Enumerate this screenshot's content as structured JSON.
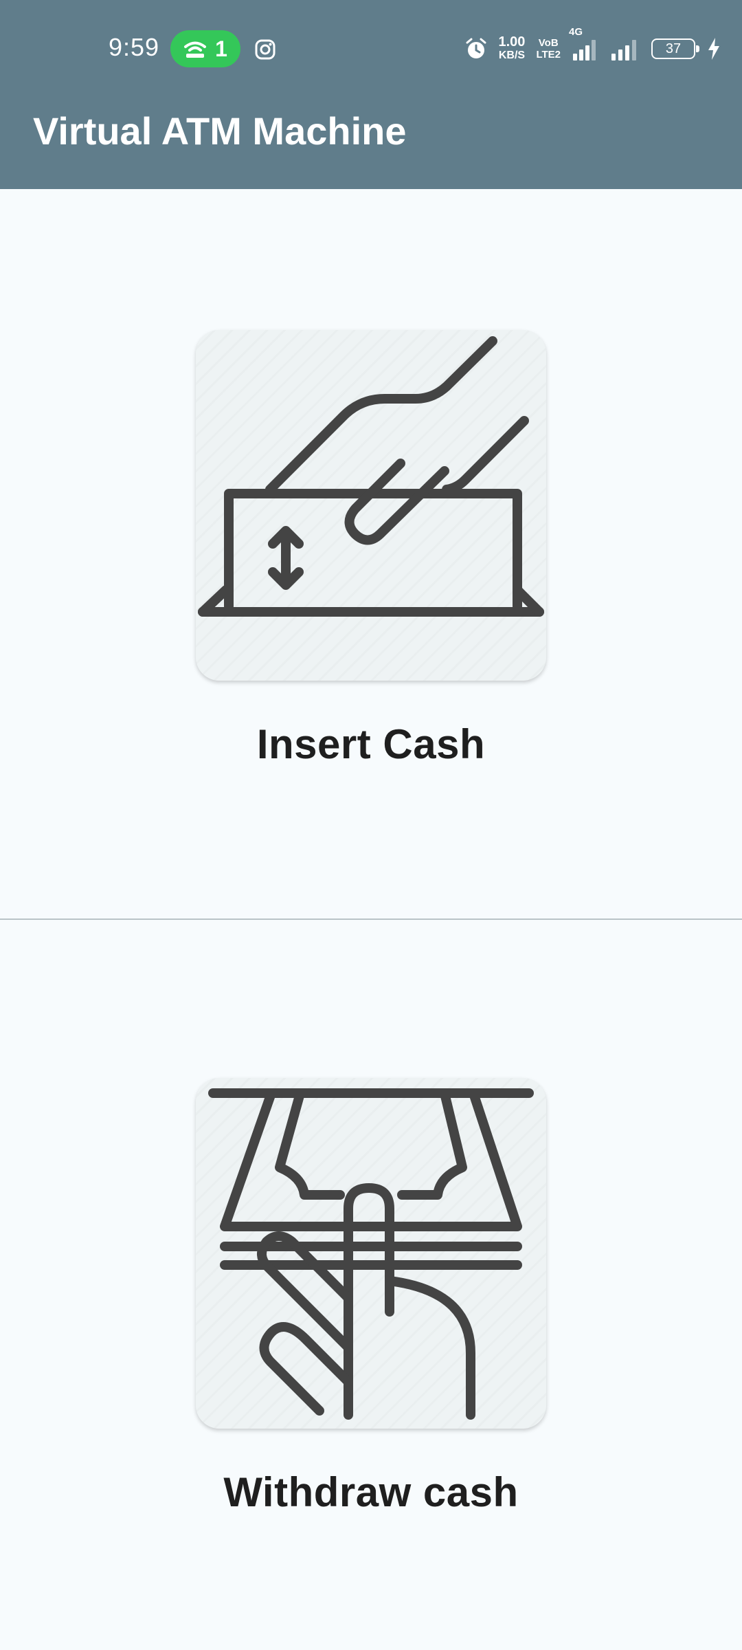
{
  "status_bar": {
    "time": "9:59",
    "hotspot_count": "1",
    "net_speed_value": "1.00",
    "net_speed_unit": "KB/S",
    "volte_top": "VoB",
    "volte_bottom": "LTE2",
    "network_type": "4G",
    "battery_level": "37",
    "icons": [
      "hotspot-icon",
      "instagram-icon",
      "alarm-icon",
      "signal-icon",
      "signal-icon",
      "battery-icon",
      "charging-icon"
    ]
  },
  "header": {
    "title": "Virtual ATM Machine",
    "background_color": "#607d8b"
  },
  "actions": [
    {
      "label": "Insert Cash",
      "icon": "insert-cash-icon"
    },
    {
      "label": "Withdraw cash",
      "icon": "withdraw-cash-icon"
    }
  ],
  "colors": {
    "background": "#f7fbfd",
    "card": "#eef3f4",
    "icon_stroke": "#444444",
    "hotspot_pill": "#34c759"
  }
}
